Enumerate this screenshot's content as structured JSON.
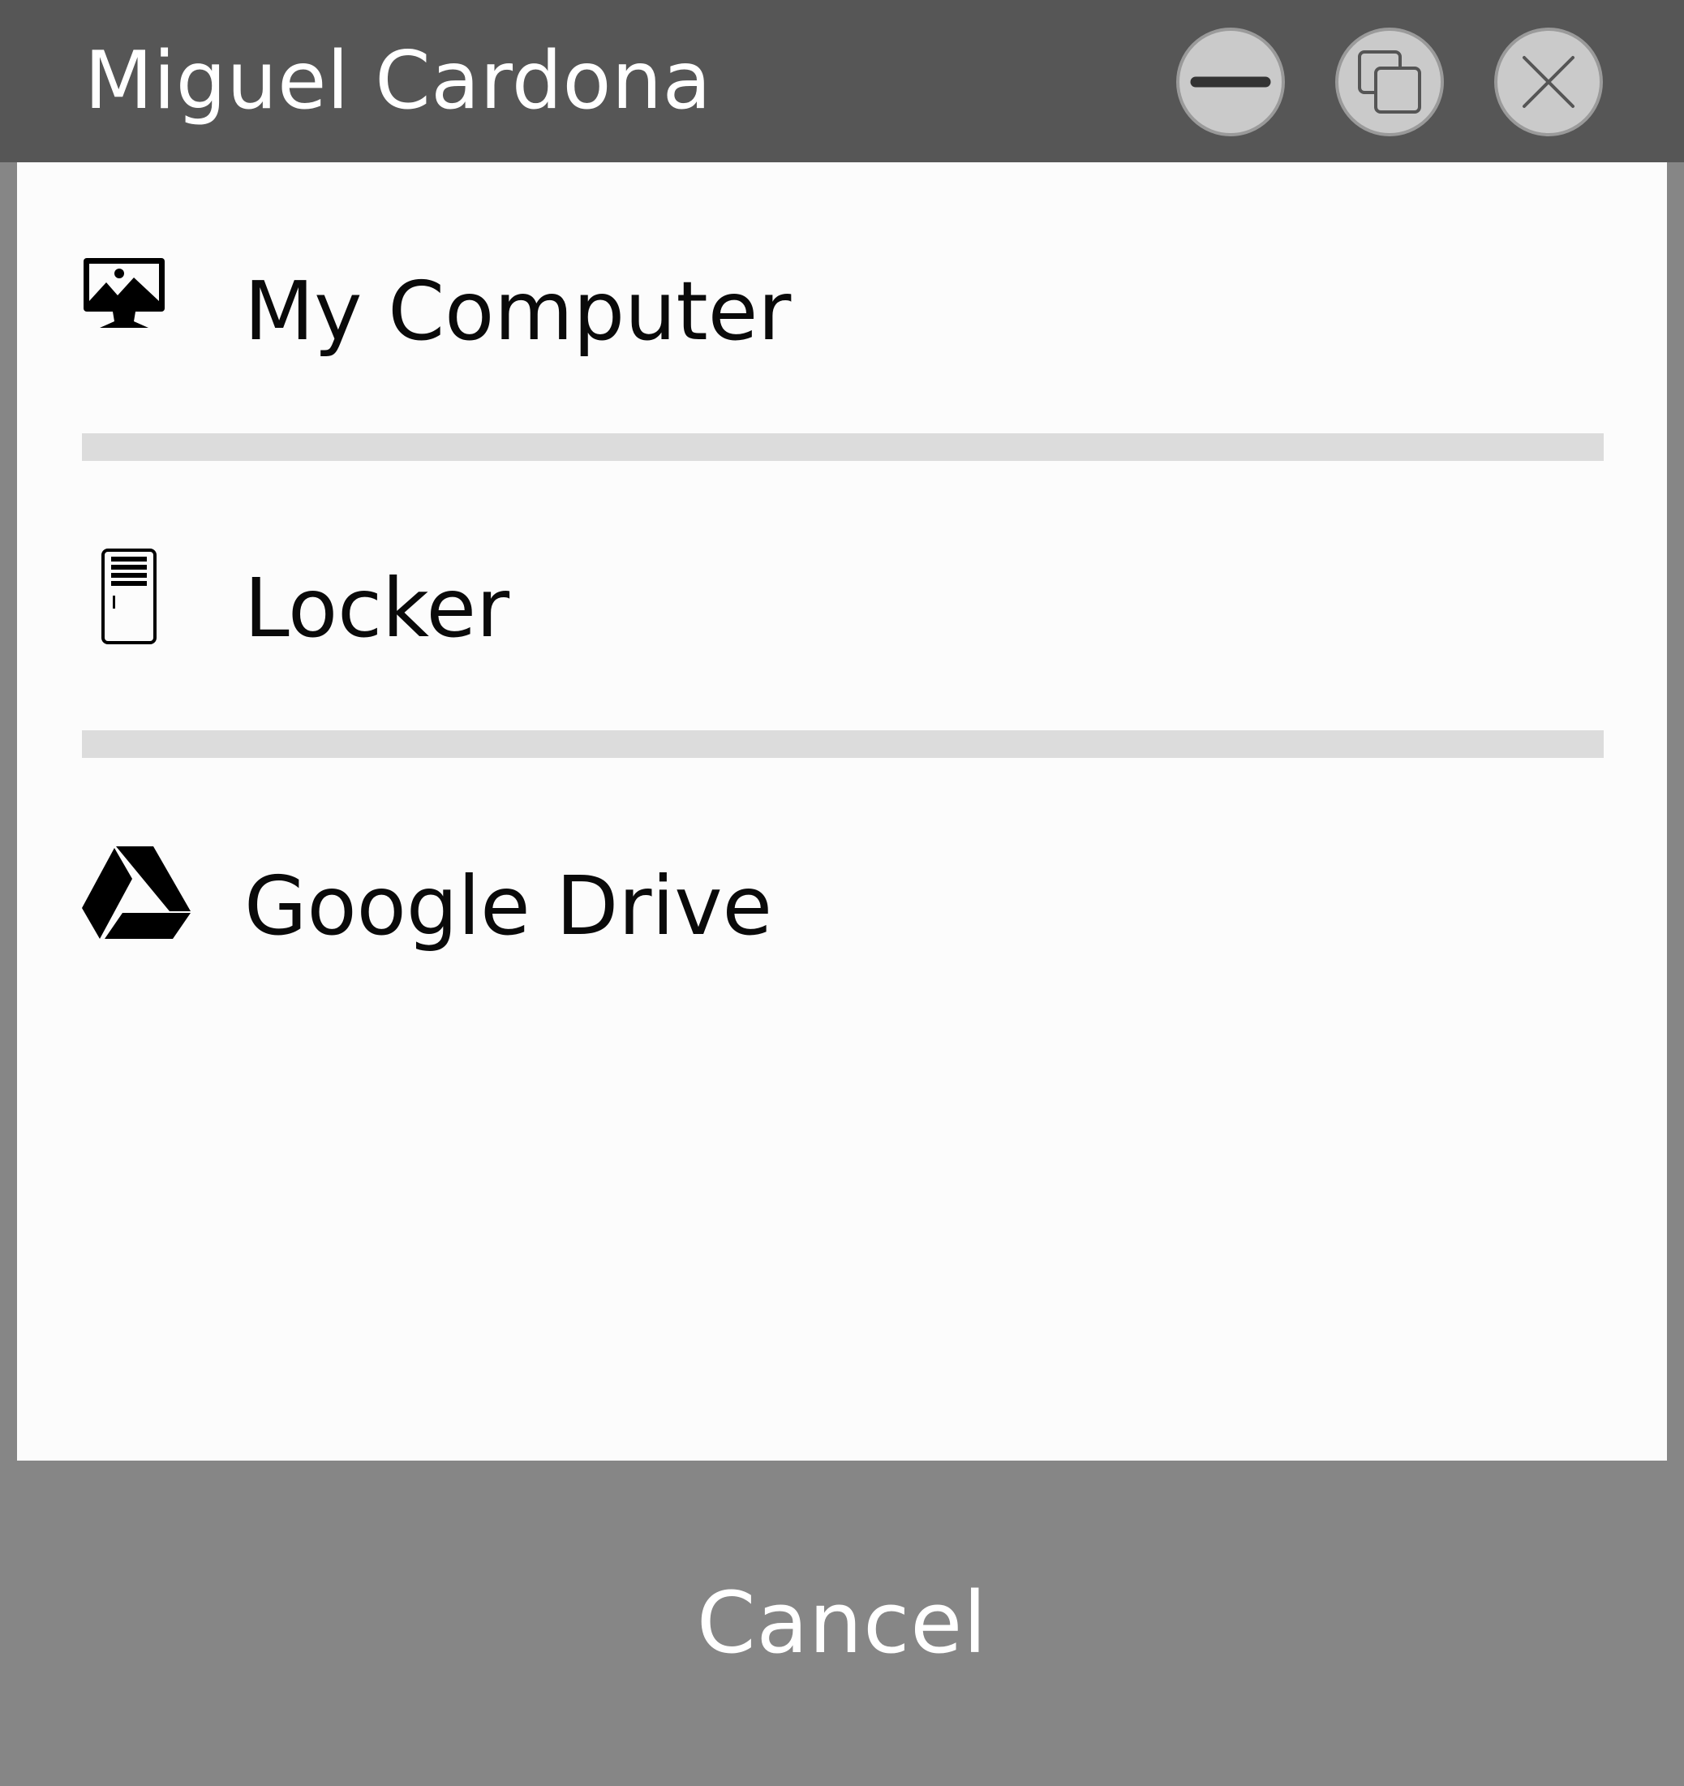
{
  "window": {
    "title": "Miguel Cardona",
    "controls": {
      "minimize_icon": "minimize-icon",
      "restore_icon": "restore-icon",
      "close_icon": "close-icon"
    }
  },
  "sources": [
    {
      "label": "My Computer",
      "icon": "computer-icon"
    },
    {
      "label": "Locker",
      "icon": "locker-icon"
    },
    {
      "label": "Google Drive",
      "icon": "google-drive-icon"
    }
  ],
  "footer": {
    "cancel_label": "Cancel"
  },
  "colors": {
    "titlebar_bg": "#565656",
    "panel_bg": "#fcfcfc",
    "divider": "#dcdcdc",
    "footer_bg": "#868686",
    "control_bg": "#cacaca",
    "text_dark": "#0a0a0a",
    "text_light": "#ffffff"
  }
}
